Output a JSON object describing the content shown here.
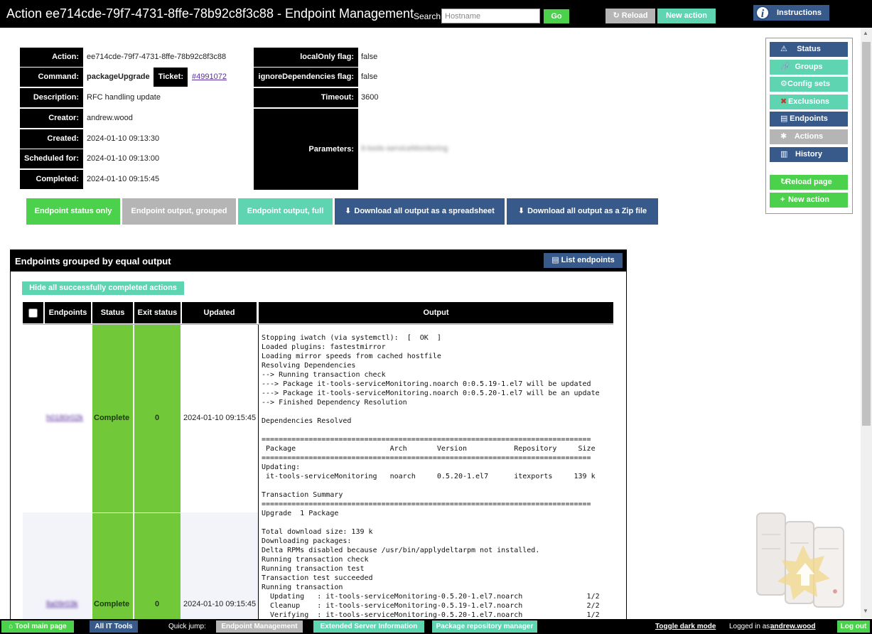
{
  "header": {
    "title": "Action ee714cde-79f7-4731-8ffe-78b92c8f3c88 - Endpoint Management",
    "search_label": "Search:",
    "search_placeholder": "Hostname",
    "go_label": "Go",
    "reload_label": "↻ Reload",
    "new_action_label": "New action",
    "instructions_label": "Instructions"
  },
  "action_info": {
    "action_label": "Action:",
    "action_value": "ee714cde-79f7-4731-8ffe-78b92c8f3c88",
    "command_label": "Command:",
    "command_value": "packageUpgrade",
    "ticket_label": "Ticket:",
    "ticket_value": "#4991072",
    "description_label": "Description:",
    "description_value": "RFC handling update",
    "creator_label": "Creator:",
    "creator_value": "andrew.wood",
    "created_label": "Created:",
    "created_value": "2024-01-10 09:13:30",
    "scheduled_label": "Scheduled for:",
    "scheduled_value": "2024-01-10 09:13:00",
    "completed_label": "Completed:",
    "completed_value": "2024-01-10 09:15:45",
    "localonly_label": "localOnly flag:",
    "localonly_value": "false",
    "ignoredeps_label": "ignoreDependencies flag:",
    "ignoredeps_value": "false",
    "timeout_label": "Timeout:",
    "timeout_value": "3600",
    "parameters_label": "Parameters:",
    "parameters_value": "it-tools-serviceMonitoring"
  },
  "output_modes": {
    "status_only": "Endpoint status only",
    "grouped": "Endpoint output, grouped",
    "full": "Endpoint output, full",
    "download_spreadsheet": "Download all output as a spreadsheet",
    "download_zip": "Download all output as a Zip file"
  },
  "sidenav": {
    "items": [
      {
        "label": "Status",
        "icon": "⚠"
      },
      {
        "label": "Groups",
        "icon": "🔗"
      },
      {
        "label": "Config sets",
        "icon": "⚙"
      },
      {
        "label": "Exclusions",
        "icon": "✖"
      },
      {
        "label": "Endpoints",
        "icon": "▤"
      },
      {
        "label": "Actions",
        "icon": "✱"
      },
      {
        "label": "History",
        "icon": "▥"
      }
    ],
    "reload_page": "Reload page",
    "new_action": "New action"
  },
  "panel": {
    "title": "Endpoints grouped by equal output",
    "list_endpoints": "List endpoints",
    "hide_completed": "Hide all successfully completed actions",
    "columns": [
      "Endpoints",
      "Status",
      "Exit status",
      "Updated",
      "Output"
    ],
    "rows": [
      {
        "endpoint": "h0180r02k",
        "status": "Complete",
        "exit": "0",
        "updated": "2024-01-10 09:15:45"
      },
      {
        "endpoint": "lla09r03k",
        "status": "Complete",
        "exit": "0",
        "updated": "2024-01-10 09:15:45"
      }
    ],
    "output_text": "Stopping iwatch (via systemctl):  [  OK  ]\nLoaded plugins: fastestmirror\nLoading mirror speeds from cached hostfile\nResolving Dependencies\n--> Running transaction check\n---> Package it-tools-serviceMonitoring.noarch 0:0.5.19-1.el7 will be updated\n---> Package it-tools-serviceMonitoring.noarch 0:0.5.20-1.el7 will be an update\n--> Finished Dependency Resolution\n\nDependencies Resolved\n\n=============================================================================\n Package                      Arch       Version           Repository     Size\n=============================================================================\nUpdating:\n it-tools-serviceMonitoring   noarch     0.5.20-1.el7      itexports     139 k\n\nTransaction Summary\n=============================================================================\nUpgrade  1 Package\n\nTotal download size: 139 k\nDownloading packages:\nDelta RPMs disabled because /usr/bin/applydeltarpm not installed.\nRunning transaction check\nRunning transaction test\nTransaction test succeeded\nRunning transaction\n  Updating   : it-tools-serviceMonitoring-0.5.20-1.el7.noarch               1/2\n  Cleanup    : it-tools-serviceMonitoring-0.5.19-1.el7.noarch               2/2\n  Verifying  : it-tools-serviceMonitoring-0.5.20-1.el7.noarch               1/2"
  },
  "footer": {
    "tool_main_page": "Tool main page",
    "all_it_tools": "All IT Tools",
    "quick_jump": "Quick jump:",
    "endpoint_management": "Endpoint Management",
    "extended_server_info": "Extended Server Information",
    "package_repo_manager": "Package repository manager",
    "toggle_dark_mode": "Toggle dark mode",
    "logged_in_as": "Logged in as:",
    "username": "andrew.wood",
    "log_out": "Log out"
  },
  "colors": {
    "green": "#4bd14b",
    "teal": "#5ed4b0",
    "navy": "#375a8a",
    "gray": "#b5b5b5",
    "status_green": "#71c838"
  }
}
